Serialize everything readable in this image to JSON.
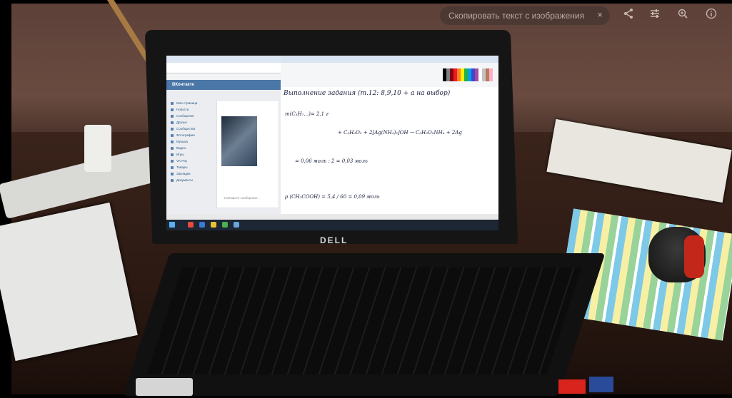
{
  "lens": {
    "copy_text_label": "Скопировать текст с изображения",
    "close_icon": "×",
    "share_icon": "share-icon",
    "adjust_icon": "sliders-icon",
    "zoom_icon": "zoom-icon",
    "info_icon": "info-icon"
  },
  "laptop": {
    "brand": "DELL"
  },
  "screen": {
    "vk": {
      "app_name": "ВКонтакте",
      "nav_items": [
        "Моя страница",
        "Новости",
        "Сообщения",
        "Друзья",
        "Сообщества",
        "Фотографии",
        "Музыка",
        "Видео",
        "Игры",
        "VK Pay",
        "Товары",
        "Закладки",
        "Документы"
      ],
      "compose_placeholder": "Напишите сообщение..."
    },
    "paint": {
      "handwriting_line1": "Выполнение задания (т.12: 8,9,10 + а на выбор)",
      "handwriting_line2": "m(C₃H₇...)= 2,1 г",
      "handwriting_line3": "+ C₃H₆O₂ + 2[Ag(NH₃)₂]OH → C₃H₅O₂NH₄ + 2Ag",
      "handwriting_line4": "= 0,06 моль : 2 = 0,03 моль",
      "handwriting_line5": "ρ (CH₃COOH) = 5,4 / 60 = 0,09 моль"
    }
  }
}
